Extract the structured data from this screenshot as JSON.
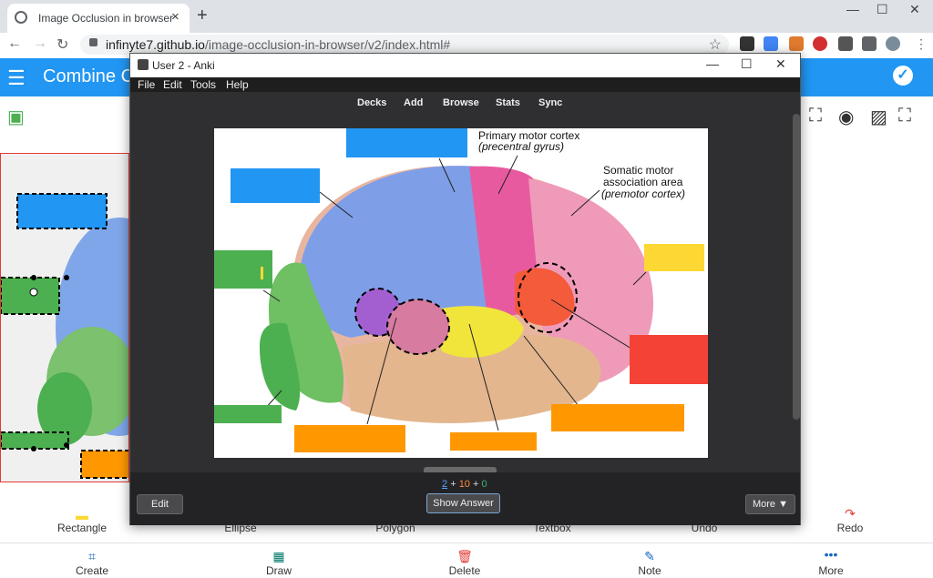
{
  "browser": {
    "tab_title": "Image Occlusion in browser",
    "url_host": "infinyte7.github.io",
    "url_path": "/image-occlusion-in-browser/v2/index.html#",
    "new_tab": "+"
  },
  "app": {
    "title": "Combine Co",
    "bottom_bar_1": [
      "Rectangle",
      "Ellipse",
      "Polygon",
      "Textbox",
      "Undo",
      "Redo"
    ],
    "bottom_bar_2": [
      "Create",
      "Draw",
      "Delete",
      "Note",
      "More"
    ]
  },
  "anki": {
    "window_title": "User 2 - Anki",
    "menu": [
      "File",
      "Edit",
      "Tools",
      "Help"
    ],
    "toolbar": [
      "Decks",
      "Add",
      "Browse",
      "Stats",
      "Sync"
    ],
    "card": {
      "label_primary_motor_1": "Primary motor cortex",
      "label_primary_motor_2": "(precentral gyrus)",
      "label_somatic_1": "Somatic motor",
      "label_somatic_2": "association area",
      "label_somatic_3": "(premotor cortex)"
    },
    "counts": {
      "new": "2",
      "learning": "10",
      "review": "0",
      "plus": "+"
    },
    "buttons": {
      "edit": "Edit",
      "show_answer": "Show Answer",
      "more": "More ▼"
    }
  },
  "colors": {
    "blue": "#2196f3",
    "green": "#4caf50",
    "orange": "#ff9800",
    "yellow": "#fdd835",
    "red": "#f44336"
  }
}
